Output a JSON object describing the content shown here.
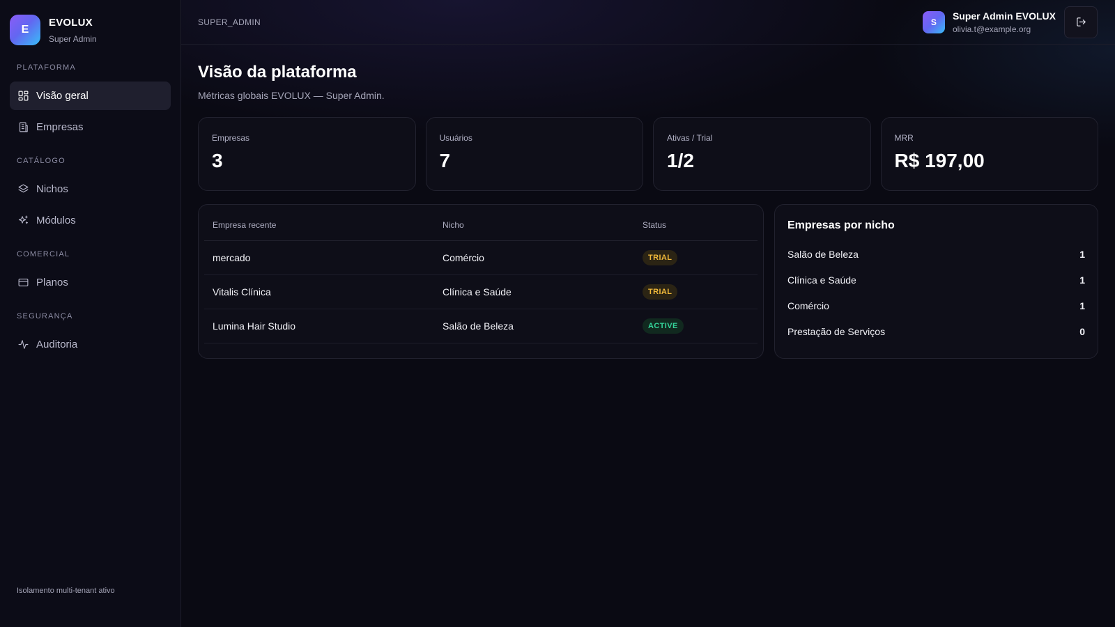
{
  "brand": {
    "logo_letter": "E",
    "name": "EVOLUX",
    "subtitle": "Super Admin"
  },
  "sidebar": {
    "sections": [
      {
        "label": "PLATAFORMA",
        "items": [
          {
            "label": "Visão geral",
            "icon": "dashboard-grid-icon",
            "active": true
          },
          {
            "label": "Empresas",
            "icon": "building-icon",
            "active": false
          }
        ]
      },
      {
        "label": "CATÁLOGO",
        "items": [
          {
            "label": "Nichos",
            "icon": "layers-icon",
            "active": false
          },
          {
            "label": "Módulos",
            "icon": "sparkles-icon",
            "active": false
          }
        ]
      },
      {
        "label": "COMERCIAL",
        "items": [
          {
            "label": "Planos",
            "icon": "credit-card-icon",
            "active": false
          }
        ]
      },
      {
        "label": "SEGURANÇA",
        "items": [
          {
            "label": "Auditoria",
            "icon": "activity-icon",
            "active": false
          }
        ]
      }
    ],
    "footer": "Isolamento multi-tenant ativo"
  },
  "topbar": {
    "role": "SUPER_ADMIN",
    "user": {
      "avatar_letter": "S",
      "name": "Super Admin EVOLUX",
      "email": "olivia.t@example.org"
    },
    "logout_icon": "logout-icon"
  },
  "page": {
    "title": "Visão da plataforma",
    "subtitle": "Métricas globais EVOLUX — Super Admin."
  },
  "stats": [
    {
      "label": "Empresas",
      "value": "3"
    },
    {
      "label": "Usuários",
      "value": "7"
    },
    {
      "label": "Ativas / Trial",
      "value": "1/2"
    },
    {
      "label": "MRR",
      "value": "R$ 197,00"
    }
  ],
  "recent_table": {
    "headers": [
      "Empresa recente",
      "Nicho",
      "Status"
    ],
    "rows": [
      {
        "empresa": "mercado",
        "nicho": "Comércio",
        "status": "TRIAL"
      },
      {
        "empresa": "Vitalis Clínica",
        "nicho": "Clínica e Saúde",
        "status": "TRIAL"
      },
      {
        "empresa": "Lumina Hair Studio",
        "nicho": "Salão de Beleza",
        "status": "ACTIVE"
      }
    ]
  },
  "niches": {
    "title": "Empresas por nicho",
    "items": [
      {
        "label": "Salão de Beleza",
        "count": "1"
      },
      {
        "label": "Clínica e Saúde",
        "count": "1"
      },
      {
        "label": "Comércio",
        "count": "1"
      },
      {
        "label": "Prestação de Serviços",
        "count": "0"
      }
    ]
  },
  "colors": {
    "accent_gradient_start": "#8b5cf6",
    "accent_gradient_end": "#38bdf8",
    "trial": "#f0b93a",
    "active": "#34d399"
  }
}
